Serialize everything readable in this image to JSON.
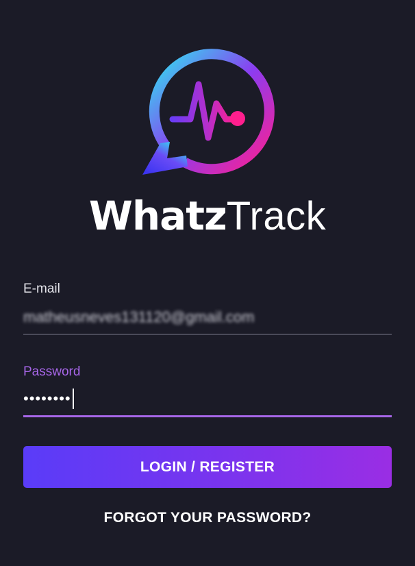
{
  "brand": {
    "name_bold": "Whatz",
    "name_light": "Track"
  },
  "logo": {
    "icon": "chat-bubble-heartbeat-icon",
    "gradient_start": "#2ee6f0",
    "gradient_mid": "#6a4cf6",
    "gradient_end": "#ff1f8e"
  },
  "form": {
    "email": {
      "label": "E-mail",
      "value": "matheusneves131120@gmail.com"
    },
    "password": {
      "label": "Password",
      "value": "••••••••"
    },
    "login_button_label": "LOGIN / REGISTER",
    "forgot_link_label": "FORGOT YOUR PASSWORD?"
  },
  "colors": {
    "background": "#1b1b27",
    "accent": "#a766e8",
    "button_start": "#5a3cf8",
    "button_end": "#9a2ee4"
  }
}
